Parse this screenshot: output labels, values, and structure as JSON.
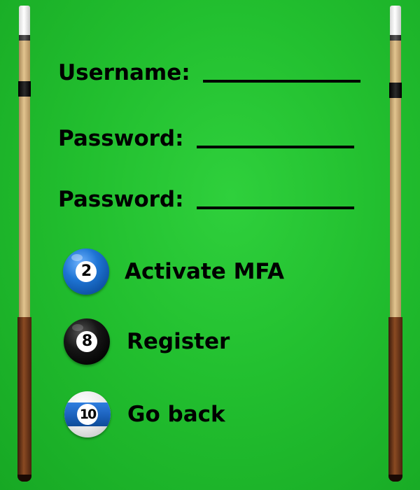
{
  "colors": {
    "felt": "#22bf2f",
    "text": "#000000",
    "ball_blue": "#1e74d4",
    "ball_black": "#000000"
  },
  "form": {
    "username_label": "Username:",
    "username_value": "",
    "password_label": "Password:",
    "password_value": "",
    "confirm_password_label": "Password:",
    "confirm_password_value": ""
  },
  "menu": {
    "items": [
      {
        "label": "Activate MFA",
        "ball_number": "2",
        "ball_style": "solid-blue",
        "icon": "billiard-ball-2-icon"
      },
      {
        "label": "Register",
        "ball_number": "8",
        "ball_style": "solid-black",
        "icon": "billiard-ball-8-icon"
      },
      {
        "label": "Go back",
        "ball_number": "10",
        "ball_style": "stripe-blue",
        "icon": "billiard-ball-10-icon"
      }
    ]
  },
  "decor": {
    "left_icon": "pool-cue-icon",
    "right_icon": "pool-cue-icon"
  }
}
